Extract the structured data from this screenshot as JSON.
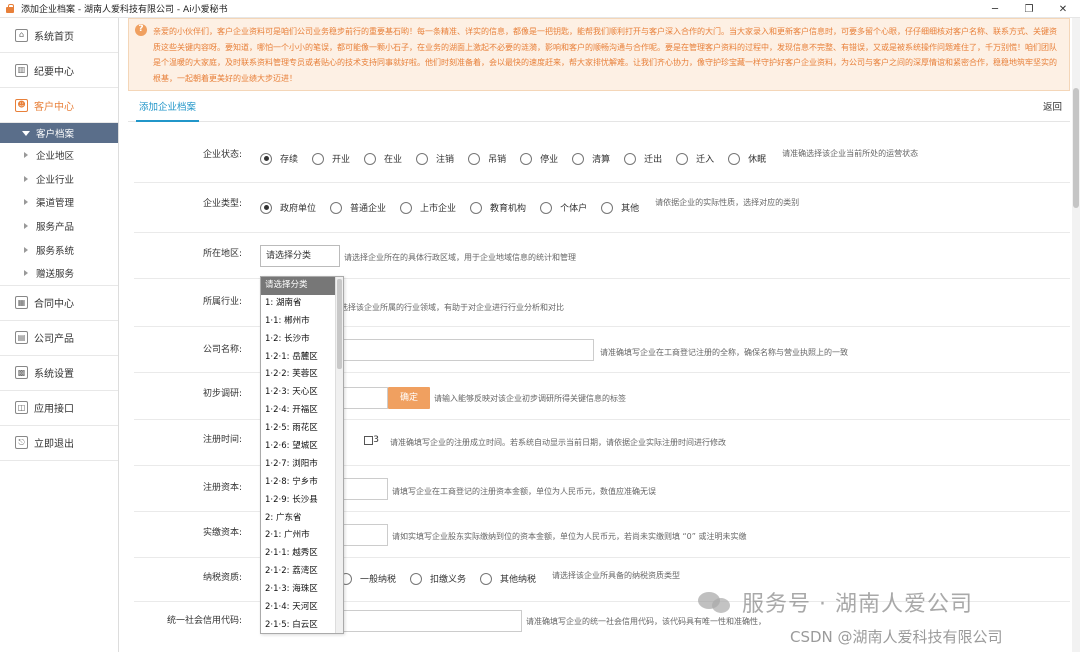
{
  "window": {
    "title": "添加企业档案 - 湖南人爱科技有限公司 - Ai小爱秘书",
    "minimize": "─",
    "maximize": "❐",
    "close": "✕"
  },
  "sidebar": {
    "menu_top": [
      {
        "label": "系统首页",
        "icon": "home-icon",
        "glyph": "⌂"
      },
      {
        "label": "纪要中心",
        "icon": "chart-icon",
        "glyph": "▥"
      },
      {
        "label": "客户中心",
        "icon": "user-icon",
        "glyph": "☻"
      }
    ],
    "submenu_head": "客户档案",
    "submenu_items": [
      "企业地区",
      "企业行业",
      "渠道管理",
      "服务产品",
      "服务系统",
      "赠送服务"
    ],
    "menu_bottom": [
      {
        "label": "合同中心",
        "icon": "calendar-icon",
        "glyph": "▦"
      },
      {
        "label": "公司产品",
        "icon": "product-icon",
        "glyph": "▤"
      },
      {
        "label": "系统设置",
        "icon": "grid-icon",
        "glyph": "▩"
      },
      {
        "label": "应用接口",
        "icon": "plugin-icon",
        "glyph": "◫"
      },
      {
        "label": "立即退出",
        "icon": "exit-icon",
        "glyph": "⎋"
      }
    ],
    "accent_color": "#e8803a",
    "submenu_color": "#5a6e8a"
  },
  "notice": {
    "text": "亲爱的小伙伴们，客户企业资料可是咱们公司业务稳步前行的重要基石哟！每一条精准、详实的信息，都像是一把钥匙，能帮我们顺利打开与客户深入合作的大门。当大家录入和更新客户信息时，可要多留个心眼，仔仔细细核对客户名称、联系方式、关键资质这些关键内容呀。要知道，哪怕一个小小的笔误，都可能像一颗小石子，在业务的湖面上激起不必要的涟漪，影响和客户的顺畅沟通与合作呢。要是在管理客户资料的过程中，发现信息不完整、有错误，又或是被系统操作问题难住了，千万别慌！咱们团队是个温暖的大家庭，及时联系资料管理专员或者贴心的技术支持同事就好啦。他们时刻准备着，会以最快的速度赶来，帮大家排忧解难。让我们齐心协力，像守护珍宝藏一样守护好客户企业资料，为公司与客户之间的深厚情谊和紧密合作，稳稳地筑牢坚实的根基，一起朝着更美好的业绩大步迈进！"
  },
  "tabs": {
    "active": "添加企业档案",
    "back": "返回"
  },
  "form": {
    "status": {
      "label": "企业状态:",
      "options": [
        "存续",
        "开业",
        "在业",
        "注销",
        "吊销",
        "停业",
        "清算",
        "迁出",
        "迁入",
        "休眠"
      ],
      "selected": 0,
      "hint": "请准确选择该企业当前所处的运营状态"
    },
    "type": {
      "label": "企业类型:",
      "options": [
        "政府单位",
        "普通企业",
        "上市企业",
        "教育机构",
        "个体户",
        "其他"
      ],
      "selected": 0,
      "hint": "请依据企业的实际性质，选择对应的类别"
    },
    "region": {
      "label": "所在地区:",
      "value": "请选择分类",
      "hint": "请选择企业所在的具体行政区域，用于企业地域信息的统计和管理"
    },
    "industry": {
      "label": "所属行业:",
      "hint": "选择该企业所属的行业领域，有助于对企业进行行业分析和对比"
    },
    "company_name": {
      "label": "公司名称:",
      "hint": "请准确填写企业在工商登记注册的全称，确保名称与营业执照上的一致"
    },
    "survey": {
      "label": "初步调研:",
      "button": "确定",
      "hint": "请输入能够反映对该企业初步调研所得关键信息的标签"
    },
    "reg_time": {
      "label": "注册时间:",
      "value": "3",
      "hint": "请准确填写企业的注册成立时间。若系统自动显示当前日期，请依据企业实际注册时间进行修改"
    },
    "reg_capital": {
      "label": "注册资本:",
      "hint": "请填写企业在工商登记的注册资本金额，单位为人民币元，数值应准确无误"
    },
    "paid_capital": {
      "label": "实缴资本:",
      "hint": "请如实填写企业股东实际缴纳到位的资本金额，单位为人民币元，若尚未实缴则填 “0” 或注明未实缴"
    },
    "tax": {
      "label": "纳税资质:",
      "options": [
        "一般纳税",
        "扣缴义务",
        "其他纳税"
      ],
      "hint": "请选择该企业所具备的纳税资质类型"
    },
    "credit_code": {
      "label": "统一社会信用代码:",
      "hint": "请准确填写企业的统一社会信用代码，该代码具有唯一性和准确性，"
    }
  },
  "region_dropdown": {
    "options": [
      "请选择分类",
      "1: 湖南省",
      "1·1: 郴州市",
      "1·2: 长沙市",
      "1·2·1: 岳麓区",
      "1·2·2: 芙蓉区",
      "1·2·3: 天心区",
      "1·2·4: 开福区",
      "1·2·5: 雨花区",
      "1·2·6: 望城区",
      "1·2·7: 浏阳市",
      "1·2·8: 宁乡市",
      "1·2·9: 长沙县",
      "2: 广东省",
      "2·1: 广州市",
      "2·1·1: 越秀区",
      "2·1·2: 荔湾区",
      "2·1·3: 海珠区",
      "2·1·4: 天河区",
      "2·1·5: 白云区"
    ],
    "selected": 0
  },
  "watermark": {
    "main": "服务号 · 湖南人爱公司",
    "csdn": "CSDN @湖南人爱科技有限公司"
  },
  "colors": {
    "notice_bg": "#fdf0e4",
    "notice_text": "#e8803a",
    "tab_active": "#2196c9",
    "button": "#f0a060"
  }
}
